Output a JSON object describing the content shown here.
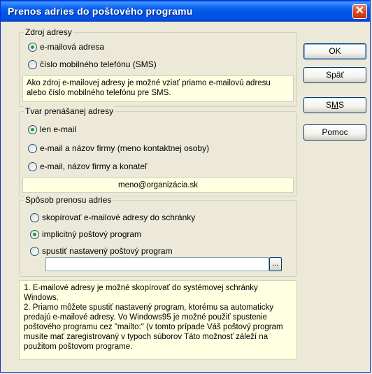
{
  "window": {
    "title": "Prenos adries do poštového programu"
  },
  "source_group": {
    "legend": "Zdroj adresy",
    "options": [
      {
        "label": "e-mailová adresa",
        "selected": true
      },
      {
        "label": "číslo mobilného telefónu (SMS)",
        "selected": false
      }
    ],
    "info": "Ako zdroj e-mailovej adresy je možné vziať priamo e-mailovú adresu alebo číslo mobilného telefónu pre SMS."
  },
  "format_group": {
    "legend": "Tvar prenášanej adresy",
    "options": [
      {
        "label": "len e-mail",
        "selected": true
      },
      {
        "label": "e-mail a názov firmy (meno kontaktnej osoby)",
        "selected": false
      },
      {
        "label": "e-mail, názov firmy a konateľ",
        "selected": false
      }
    ],
    "preview": "meno@organizácia.sk"
  },
  "transfer_group": {
    "legend": "Spôsob prenosu adries",
    "options": [
      {
        "label": "skopírovať e-mailové adresy do schránky",
        "selected": false
      },
      {
        "label": "implicitný poštový program",
        "selected": true
      },
      {
        "label": "spustiť nastavený poštový program",
        "selected": false
      }
    ],
    "program_path": {
      "value": "",
      "browse_label": "..."
    },
    "info": [
      "1. E-mailové adresy je možné skopírovať do systémovej schránky Windows.",
      "2. Priamo môžete spustiť nastavený program, ktorému sa automaticky predajú e-mailové adresy. Vo Windows95 je možné použiť spustenie poštového programu cez \"mailto:\" (v tomto prípade Váš poštový program musíte mať zaregistrovaný v typoch súborov Táto možnosť záleží na použitom poštovom programe."
    ]
  },
  "buttons": {
    "ok": "OK",
    "back": "Späť",
    "sms_prefix": "S",
    "sms_accel": "M",
    "sms_suffix": "S",
    "help": "Pomoc"
  },
  "icons": {
    "close": "close-icon",
    "radio": "radio-icon"
  },
  "colors": {
    "titlebar": "#0054e3",
    "info_bg": "#ffffe1",
    "dialog_bg": "#ece9d8",
    "radio_dot": "#21a121"
  }
}
